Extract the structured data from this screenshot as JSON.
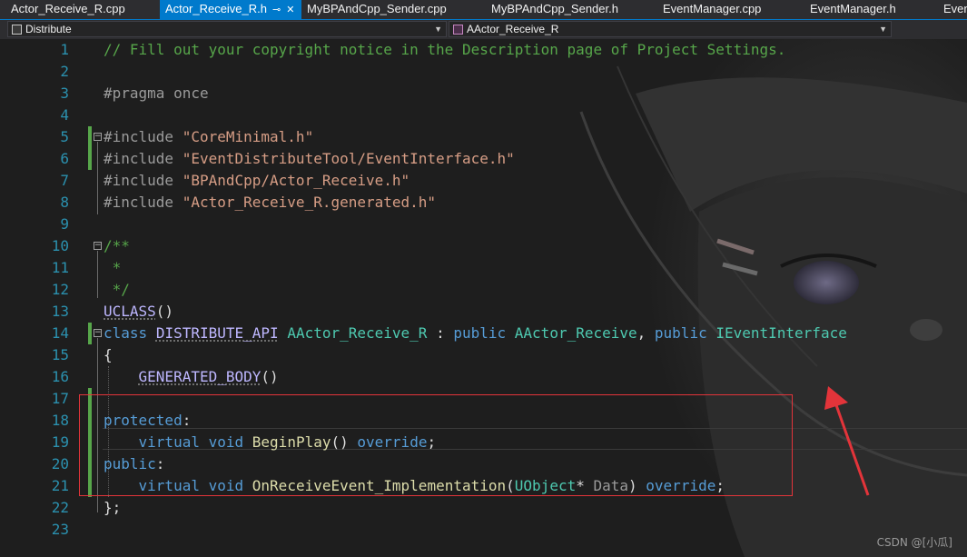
{
  "tabs": [
    {
      "label": "Actor_Receive_R.cpp",
      "active": false
    },
    {
      "label": "Actor_Receive_R.h",
      "active": true
    },
    {
      "label": "MyBPAndCpp_Sender.cpp",
      "active": false
    },
    {
      "label": "MyBPAndCpp_Sender.h",
      "active": false
    },
    {
      "label": "EventManager.cpp",
      "active": false
    },
    {
      "label": "EventManager.h",
      "active": false
    },
    {
      "label": "Even",
      "active": false
    }
  ],
  "tab_icons": {
    "pin": "⊸",
    "close": "✕"
  },
  "nav": {
    "project": "Distribute",
    "scope": "AActor_Receive_R",
    "project_icon": "project-icon",
    "scope_icon": "class-icon"
  },
  "code_lines": [
    {
      "num": "1",
      "text": "// Fill out your copyright notice in the Description page of Project Settings."
    },
    {
      "num": "2",
      "text": ""
    },
    {
      "num": "3",
      "text": "#pragma once"
    },
    {
      "num": "4",
      "text": ""
    },
    {
      "num": "5",
      "text": "#include \"CoreMinimal.h\""
    },
    {
      "num": "6",
      "text": "#include \"EventDistributeTool/EventInterface.h\""
    },
    {
      "num": "7",
      "text": "#include \"BPAndCpp/Actor_Receive.h\""
    },
    {
      "num": "8",
      "text": "#include \"Actor_Receive_R.generated.h\""
    },
    {
      "num": "9",
      "text": ""
    },
    {
      "num": "10",
      "text": "/**"
    },
    {
      "num": "11",
      "text": " *"
    },
    {
      "num": "12",
      "text": " */"
    },
    {
      "num": "13",
      "text": "UCLASS()"
    },
    {
      "num": "14",
      "text": "class DISTRIBUTE_API AActor_Receive_R : public AActor_Receive, public IEventInterface"
    },
    {
      "num": "15",
      "text": "{"
    },
    {
      "num": "16",
      "text": "    GENERATED_BODY()"
    },
    {
      "num": "17",
      "text": ""
    },
    {
      "num": "18",
      "text": "protected:"
    },
    {
      "num": "19",
      "text": "    virtual void BeginPlay() override;"
    },
    {
      "num": "20",
      "text": "public:"
    },
    {
      "num": "21",
      "text": "    virtual void OnReceiveEvent_Implementation(UObject* Data) override;"
    },
    {
      "num": "22",
      "text": "};"
    },
    {
      "num": "23",
      "text": ""
    }
  ],
  "colors": {
    "comment": "#57a64a",
    "keyword": "#569cd6",
    "string": "#d69d85",
    "type": "#4ec9b0",
    "macro": "#beb7ff",
    "function": "#dcdcaa",
    "line_number": "#2b91af",
    "change_marker": "#57a64a",
    "highlight_box": "#e3343a",
    "accent": "#007acc"
  },
  "watermark": "CSDN @[小瓜]"
}
